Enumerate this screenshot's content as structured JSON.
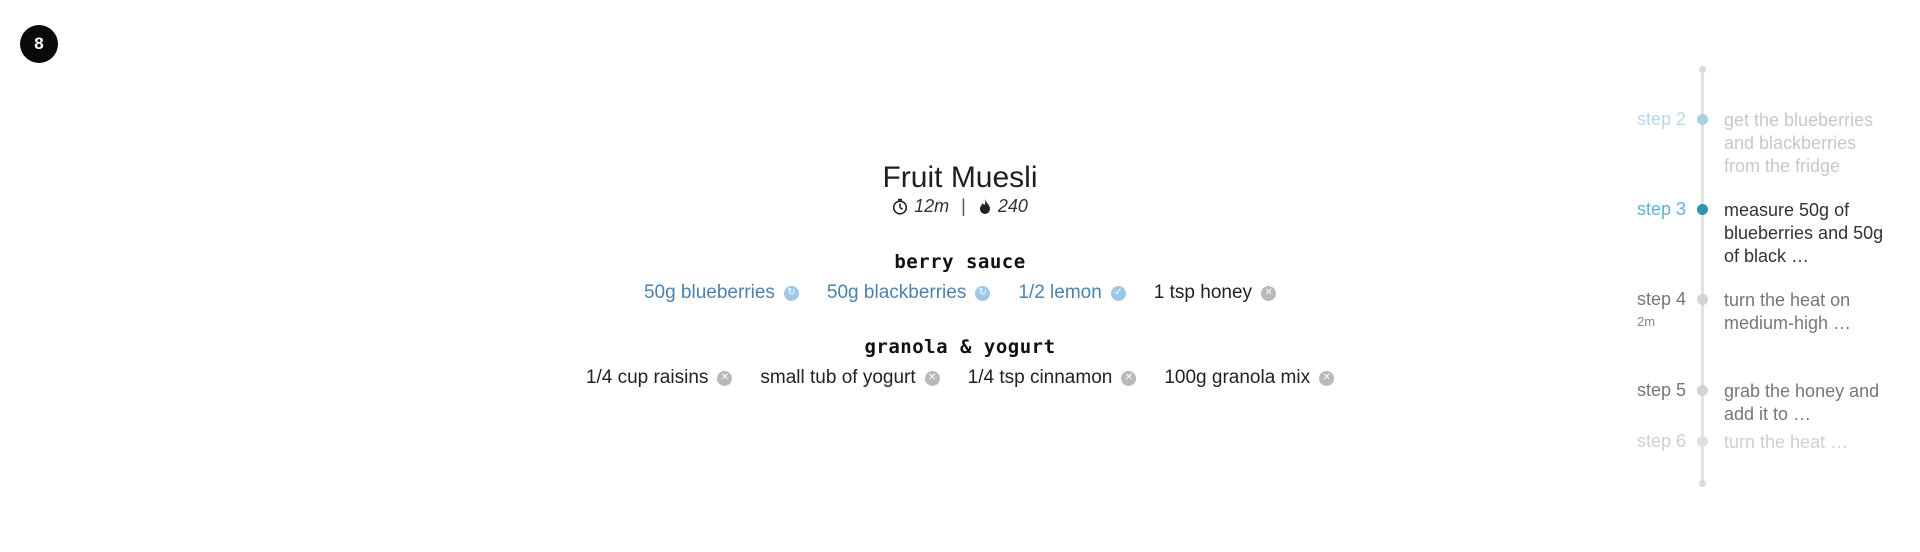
{
  "step_badge": "8",
  "recipe": {
    "title": "Fruit Muesli",
    "time": "12m",
    "separator": "|",
    "calories": "240"
  },
  "sections": [
    {
      "title": "berry sauce",
      "ingredients": [
        {
          "label": "50g blueberries",
          "state": "in-use",
          "marker_icon": "refresh-icon"
        },
        {
          "label": "50g blackberries",
          "state": "in-use",
          "marker_icon": "refresh-icon"
        },
        {
          "label": "1/2 lemon",
          "state": "done",
          "marker_icon": "check-icon"
        },
        {
          "label": "1 tsp honey",
          "state": "pending",
          "marker_icon": "close-icon"
        }
      ]
    },
    {
      "title": "granola & yogurt",
      "ingredients": [
        {
          "label": "1/4 cup raisins",
          "state": "pending",
          "marker_icon": "close-icon"
        },
        {
          "label": "small tub of yogurt",
          "state": "pending",
          "marker_icon": "close-icon"
        },
        {
          "label": "1/4 tsp cinnamon",
          "state": "pending",
          "marker_icon": "close-icon"
        },
        {
          "label": "100g granola mix",
          "state": "pending",
          "marker_icon": "close-icon"
        }
      ]
    }
  ],
  "timeline": {
    "steps": [
      {
        "label": "step 2",
        "sub": "",
        "text": "get the blueberries and blackberries from the fridge",
        "state": "past"
      },
      {
        "label": "step 3",
        "sub": "",
        "text": "measure 50g of blueberries and 50g of black …",
        "state": "current"
      },
      {
        "label": "step 4",
        "sub": "2m",
        "text": "turn the heat on medium-high …",
        "state": "upcoming"
      },
      {
        "label": "step 5",
        "sub": "",
        "text": "grab the honey and add it to …",
        "state": "upcoming"
      },
      {
        "label": "step 6",
        "sub": "",
        "text": "turn the heat …",
        "state": "faded"
      }
    ]
  },
  "colors": {
    "accent_teal": "#2f94b0",
    "past_blue": "#a9cfe4",
    "ingredient_blue": "#4a83b0",
    "grey_marker": "#b9b9b9"
  }
}
